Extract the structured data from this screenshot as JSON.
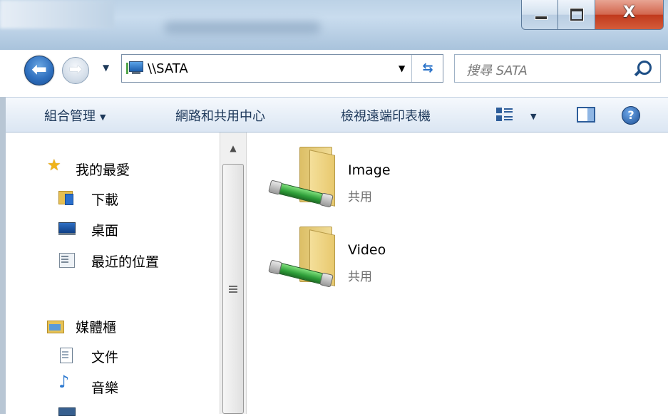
{
  "window": {
    "close_glyph": "X"
  },
  "nav": {
    "back_glyph": "⬅",
    "forward_glyph": "➡",
    "history_caret": "▼"
  },
  "address": {
    "path": "\\\\SATA",
    "dropdown_caret": "▼",
    "refresh_glyph": "⇆"
  },
  "search": {
    "placeholder": "搜尋 SATA"
  },
  "toolbar": {
    "organize": "組合管理",
    "organize_caret": "▼",
    "network_center": "網路和共用中心",
    "view_printers": "檢視遠端印表機",
    "views_caret": "▼",
    "help_glyph": "?"
  },
  "sidebar": {
    "favorites": {
      "label": "我的最愛",
      "icon": "star-icon"
    },
    "downloads": {
      "label": "下載",
      "icon": "downloads-folder-icon"
    },
    "desktop": {
      "label": "桌面",
      "icon": "desktop-icon"
    },
    "recent": {
      "label": "最近的位置",
      "icon": "recent-places-icon"
    },
    "libraries": {
      "label": "媒體櫃",
      "icon": "libraries-icon"
    },
    "documents": {
      "label": "文件",
      "icon": "documents-icon"
    },
    "music": {
      "label": "音樂",
      "icon": "music-icon"
    }
  },
  "scrollbar": {
    "up_glyph": "▲"
  },
  "shares": [
    {
      "name": "Image",
      "type": "共用",
      "icon": "shared-folder-icon"
    },
    {
      "name": "Video",
      "type": "共用",
      "icon": "shared-folder-icon"
    }
  ],
  "colors": {
    "toolbar_text": "#1e395b",
    "close_button": "#c0391c",
    "share_pipe": "#2f9f3a"
  }
}
